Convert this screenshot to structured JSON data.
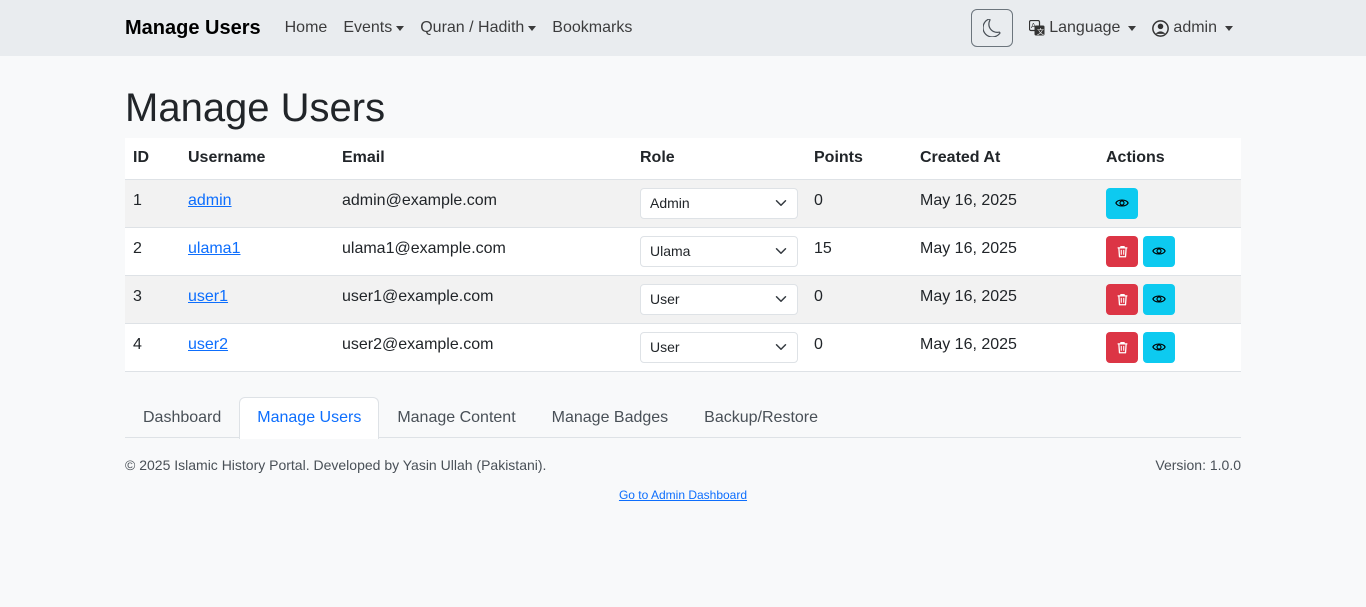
{
  "navbar": {
    "brand": "Manage Users",
    "links": [
      {
        "label": "Home",
        "dropdown": false
      },
      {
        "label": "Events",
        "dropdown": true
      },
      {
        "label": "Quran / Hadith",
        "dropdown": true
      },
      {
        "label": "Bookmarks",
        "dropdown": false
      }
    ],
    "language_label": "Language",
    "user_label": "admin"
  },
  "page": {
    "title": "Manage Users"
  },
  "table": {
    "headers": [
      "ID",
      "Username",
      "Email",
      "Role",
      "Points",
      "Created At",
      "Actions"
    ],
    "rows": [
      {
        "id": "1",
        "username": "admin",
        "email": "admin@example.com",
        "role": "Admin",
        "points": "0",
        "created": "May 16, 2025",
        "can_delete": false
      },
      {
        "id": "2",
        "username": "ulama1",
        "email": "ulama1@example.com",
        "role": "Ulama",
        "points": "15",
        "created": "May 16, 2025",
        "can_delete": true
      },
      {
        "id": "3",
        "username": "user1",
        "email": "user1@example.com",
        "role": "User",
        "points": "0",
        "created": "May 16, 2025",
        "can_delete": true
      },
      {
        "id": "4",
        "username": "user2",
        "email": "user2@example.com",
        "role": "User",
        "points": "0",
        "created": "May 16, 2025",
        "can_delete": true
      }
    ]
  },
  "tabs": [
    {
      "label": "Dashboard",
      "active": false
    },
    {
      "label": "Manage Users",
      "active": true
    },
    {
      "label": "Manage Content",
      "active": false
    },
    {
      "label": "Manage Badges",
      "active": false
    },
    {
      "label": "Backup/Restore",
      "active": false
    }
  ],
  "footer": {
    "copyright": "© 2025 Islamic History Portal. Developed by Yasin Ullah (Pakistani).",
    "version": "Version: 1.0.0",
    "admin_link": "Go to Admin Dashboard"
  },
  "colors": {
    "primary": "#0d6efd",
    "danger": "#dc3545",
    "info": "#0dcaf0"
  },
  "icons": {
    "theme": "moon-icon",
    "language": "translate-icon",
    "user": "person-circle-icon",
    "delete": "trash-icon",
    "view": "eye-icon",
    "select": "chevron-down-icon"
  }
}
